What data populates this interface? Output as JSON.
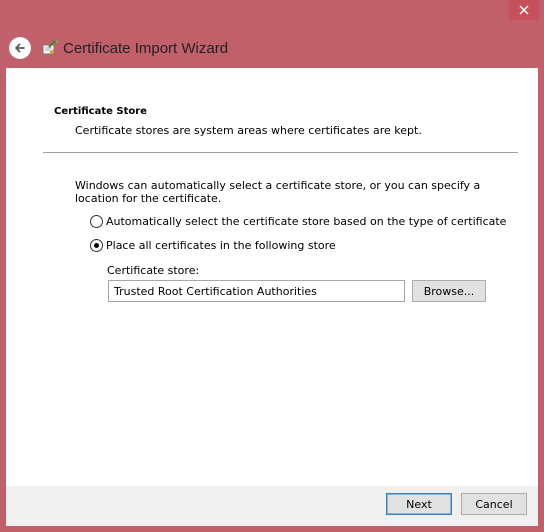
{
  "window": {
    "title": "Certificate Import Wizard",
    "close_symbol": "✕"
  },
  "icons": {
    "back": "back-arrow-icon",
    "wizard": "certificate-wizard-icon",
    "close": "close-icon"
  },
  "section": {
    "title": "Certificate Store",
    "description": "Certificate stores are system areas where certificates are kept."
  },
  "intro": "Windows can automatically select a certificate store, or you can specify a location for the certificate.",
  "options": [
    {
      "label": "Automatically select the certificate store based on the type of certificate",
      "checked": false
    },
    {
      "label": "Place all certificates in the following store",
      "checked": true
    }
  ],
  "store": {
    "label": "Certificate store:",
    "value": "Trusted Root Certification Authorities",
    "browse_label": "Browse..."
  },
  "footer": {
    "next_label": "Next",
    "cancel_label": "Cancel"
  },
  "colors": {
    "frame": "#c15f6a",
    "close_button": "#c7505d",
    "default_button_border": "#3c7fb1"
  }
}
